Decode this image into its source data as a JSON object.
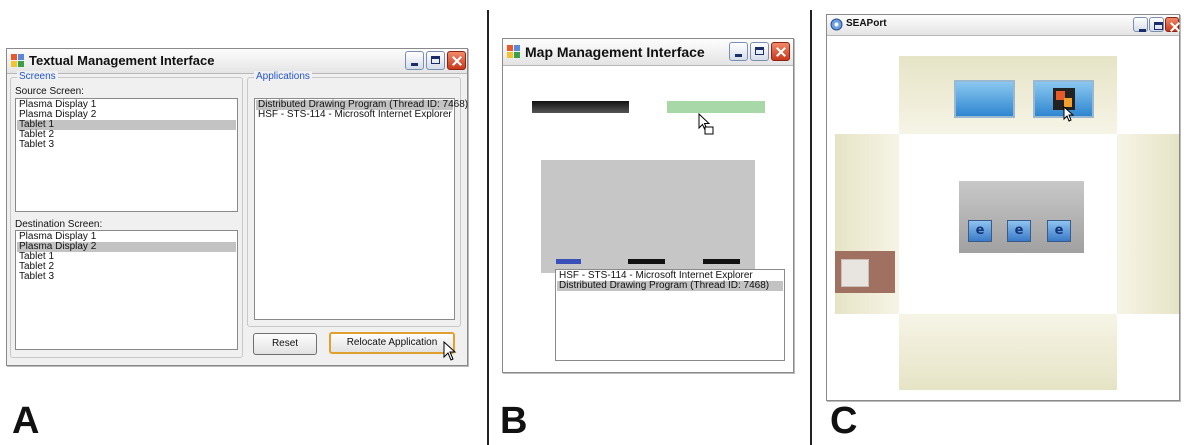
{
  "figure_labels": {
    "a": "A",
    "b": "B",
    "c": "C"
  },
  "textual": {
    "title": "Textual Management Interface",
    "screens_group": "Screens",
    "source_label": "Source Screen:",
    "source_items": [
      "Plasma Display 1",
      "Plasma Display 2",
      "Tablet 1",
      "Tablet 2",
      "Tablet 3"
    ],
    "source_selected_index": 2,
    "destination_label": "Destination Screen:",
    "destination_items": [
      "Plasma Display 1",
      "Plasma Display 2",
      "Tablet 1",
      "Tablet 2",
      "Tablet 3"
    ],
    "destination_selected_index": 1,
    "applications_group": "Applications",
    "application_items": [
      "Distributed Drawing Program (Thread ID: 7468)",
      "HSF - STS-114 - Microsoft Internet Explorer"
    ],
    "application_selected_index": 0,
    "reset_label": "Reset",
    "relocate_label": "Relocate Application"
  },
  "map": {
    "title": "Map Management Interface",
    "popup_items": [
      "HSF - STS-114 - Microsoft Internet Explorer",
      "Distributed Drawing Program (Thread ID: 7468)"
    ],
    "popup_selected_index": 1,
    "colors": {
      "highlight_display": "#a8d8a8",
      "selected_wall_segment": "#3a50b8"
    }
  },
  "seaport": {
    "title": "SEAPort"
  },
  "colors": {
    "selection": "#c3c3c3",
    "group_legend": "#2456c8",
    "close_button": "#c8381c"
  }
}
